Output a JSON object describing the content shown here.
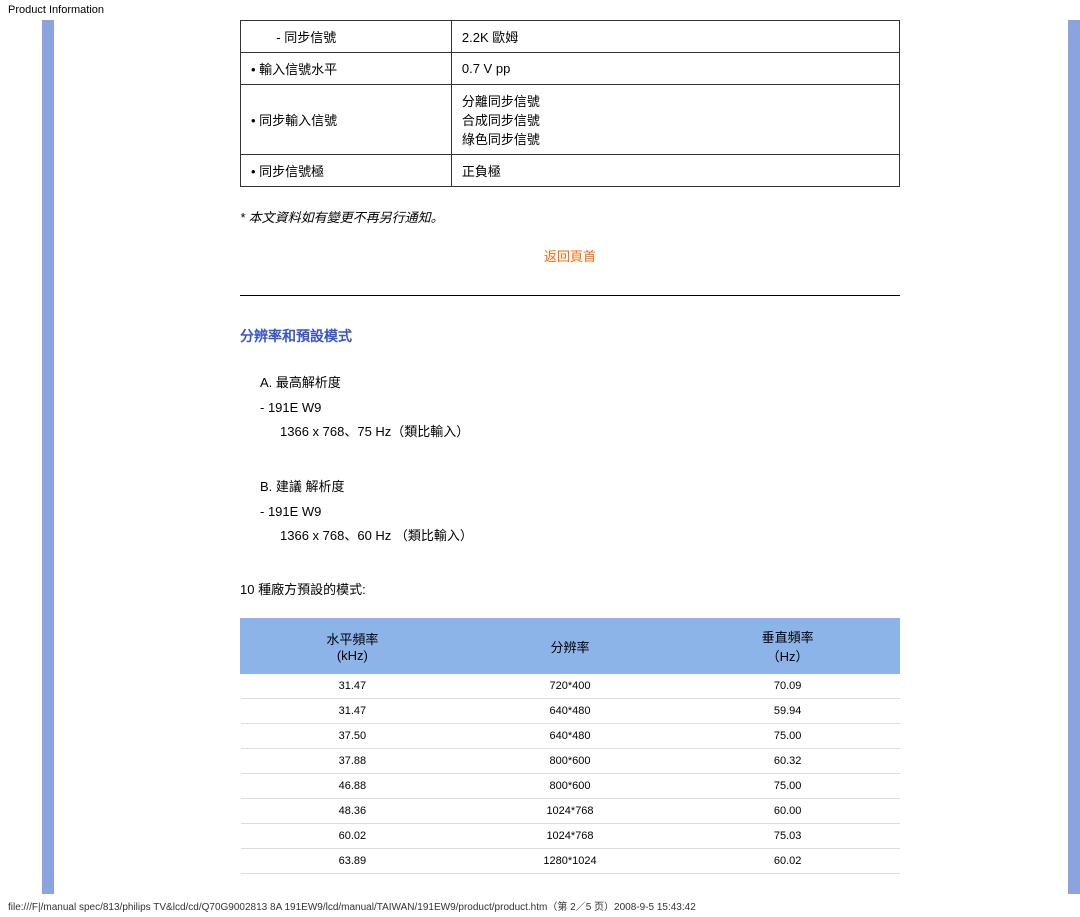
{
  "page_title": "Product Information",
  "spec_table": {
    "rows": [
      {
        "label": "       - 同步信號",
        "value": "2.2K 歐姆"
      },
      {
        "label": "• 輸入信號水平",
        "value": "0.7 V pp"
      },
      {
        "label": "• 同步輸入信號",
        "value": "分離同步信號\n合成同步信號\n綠色同步信號"
      },
      {
        "label": "• 同步信號極",
        "value": "正負極"
      }
    ]
  },
  "note": "* 本文資料如有變更不再另行通知。",
  "back_top": "返回頁首",
  "section_title": "分辨率和預設模式",
  "max_res": {
    "heading": "A.  最高解析度",
    "item1": "-   191E W9",
    "item2": "1366 x 768、75 Hz（類比輸入）"
  },
  "rec_res": {
    "heading": "B.  建議 解析度",
    "item1": "-   191E W9",
    "item2": "1366 x 768、60 Hz （類比輸入）"
  },
  "modes_title": "10 種廠方預設的模式:",
  "chart_data": {
    "type": "table",
    "columns": [
      {
        "label_line1": "水平頻率",
        "label_line2": "(kHz)"
      },
      {
        "label_line1": "分辨率",
        "label_line2": ""
      },
      {
        "label_line1": "垂直頻率",
        "label_line2": "（Hz）"
      }
    ],
    "rows": [
      {
        "h": "31.47",
        "res": "720*400",
        "v": "70.09"
      },
      {
        "h": "31.47",
        "res": "640*480",
        "v": "59.94"
      },
      {
        "h": "37.50",
        "res": "640*480",
        "v": "75.00"
      },
      {
        "h": "37.88",
        "res": "800*600",
        "v": "60.32"
      },
      {
        "h": "46.88",
        "res": "800*600",
        "v": "75.00"
      },
      {
        "h": "48.36",
        "res": "1024*768",
        "v": "60.00"
      },
      {
        "h": "60.02",
        "res": "1024*768",
        "v": "75.03"
      },
      {
        "h": "63.89",
        "res": "1280*1024",
        "v": "60.02"
      }
    ]
  },
  "footer": "file:///F|/manual spec/813/philips TV&lcd/cd/Q70G9002813 8A 191EW9/lcd/manual/TAIWAN/191EW9/product/product.htm（第 2／5 页）2008-9-5 15:43:42"
}
